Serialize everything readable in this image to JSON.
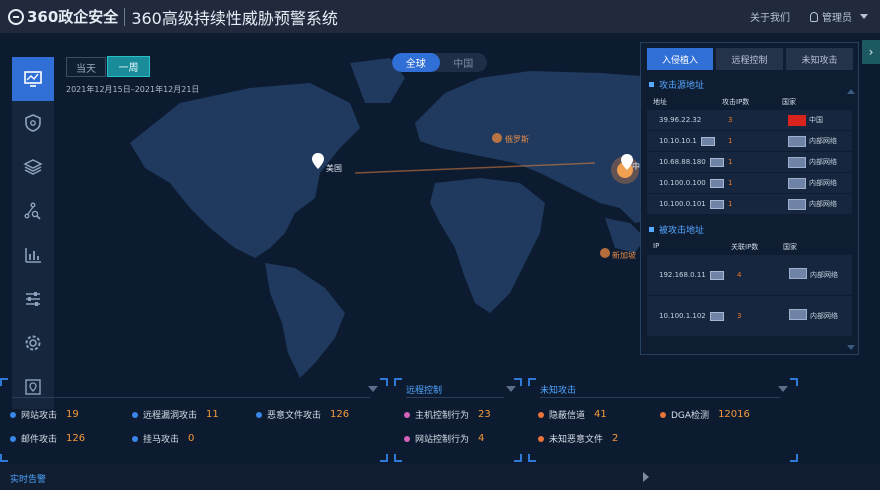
{
  "header": {
    "brand": "360政企安全",
    "title": "360高级持续性威胁预警系统",
    "about": "关于我们",
    "user": "管理员"
  },
  "sidebar": {
    "items": [
      {
        "icon": "monitor-icon",
        "active": true
      },
      {
        "icon": "shield-icon",
        "active": false
      },
      {
        "icon": "layers-icon",
        "active": false
      },
      {
        "icon": "network-search-icon",
        "active": false
      },
      {
        "icon": "bar-chart-icon",
        "active": false
      },
      {
        "icon": "sliders-icon",
        "active": false
      },
      {
        "icon": "settings-icon",
        "active": false
      },
      {
        "icon": "map-pin-icon",
        "active": false
      }
    ]
  },
  "map": {
    "range_day": "当天",
    "range_week": "一周",
    "date_range": "2021年12月15日–2021年12月21日",
    "scope_global": "全球",
    "scope_china": "中国",
    "labels": {
      "usa": "美国",
      "russia": "俄罗斯",
      "singapore": "新加坡",
      "china_partial": "中"
    }
  },
  "right_panel": {
    "tabs": [
      "入侵植入",
      "远程控制",
      "未知攻击"
    ],
    "source": {
      "title": "攻击源地址",
      "headers": [
        "地址",
        "攻击IP数",
        "国家"
      ],
      "rows": [
        {
          "ip": "39.96.22.32",
          "count": "3",
          "country": "中国",
          "flag": "cn",
          "card": false
        },
        {
          "ip": "10.10.10.1",
          "count": "1",
          "country": "内部网络",
          "flag": "lan",
          "card": true
        },
        {
          "ip": "10.68.88.180",
          "count": "1",
          "country": "内部网络",
          "flag": "lan",
          "card": true
        },
        {
          "ip": "10.100.0.100",
          "count": "1",
          "country": "内部网络",
          "flag": "lan",
          "card": true
        },
        {
          "ip": "10.100.0.101",
          "count": "1",
          "country": "内部网络",
          "flag": "lan",
          "card": true
        }
      ]
    },
    "target": {
      "title": "被攻击地址",
      "headers": [
        "IP",
        "关联IP数",
        "国家"
      ],
      "rows": [
        {
          "ip": "192.168.0.11",
          "count": "4",
          "country": "内部网络"
        },
        {
          "ip": "10.100.1.102",
          "count": "3",
          "country": "内部网络"
        }
      ]
    }
  },
  "stats": {
    "intrusion": {
      "title": "",
      "items": [
        {
          "label": "网站攻击",
          "value": "19"
        },
        {
          "label": "远程漏洞攻击",
          "value": "11"
        },
        {
          "label": "恶意文件攻击",
          "value": "126"
        },
        {
          "label": "邮件攻击",
          "value": "126"
        },
        {
          "label": "挂马攻击",
          "value": "0"
        }
      ]
    },
    "remote": {
      "title": "远程控制",
      "items": [
        {
          "label": "主机控制行为",
          "value": "23"
        },
        {
          "label": "网站控制行为",
          "value": "4"
        }
      ]
    },
    "unknown": {
      "title": "未知攻击",
      "items": [
        {
          "label": "隐蔽信道",
          "value": "41"
        },
        {
          "label": "DGA检测",
          "value": "12016"
        },
        {
          "label": "未知恶意文件",
          "value": "2"
        }
      ]
    }
  },
  "alarm": {
    "title": "实时告警"
  }
}
